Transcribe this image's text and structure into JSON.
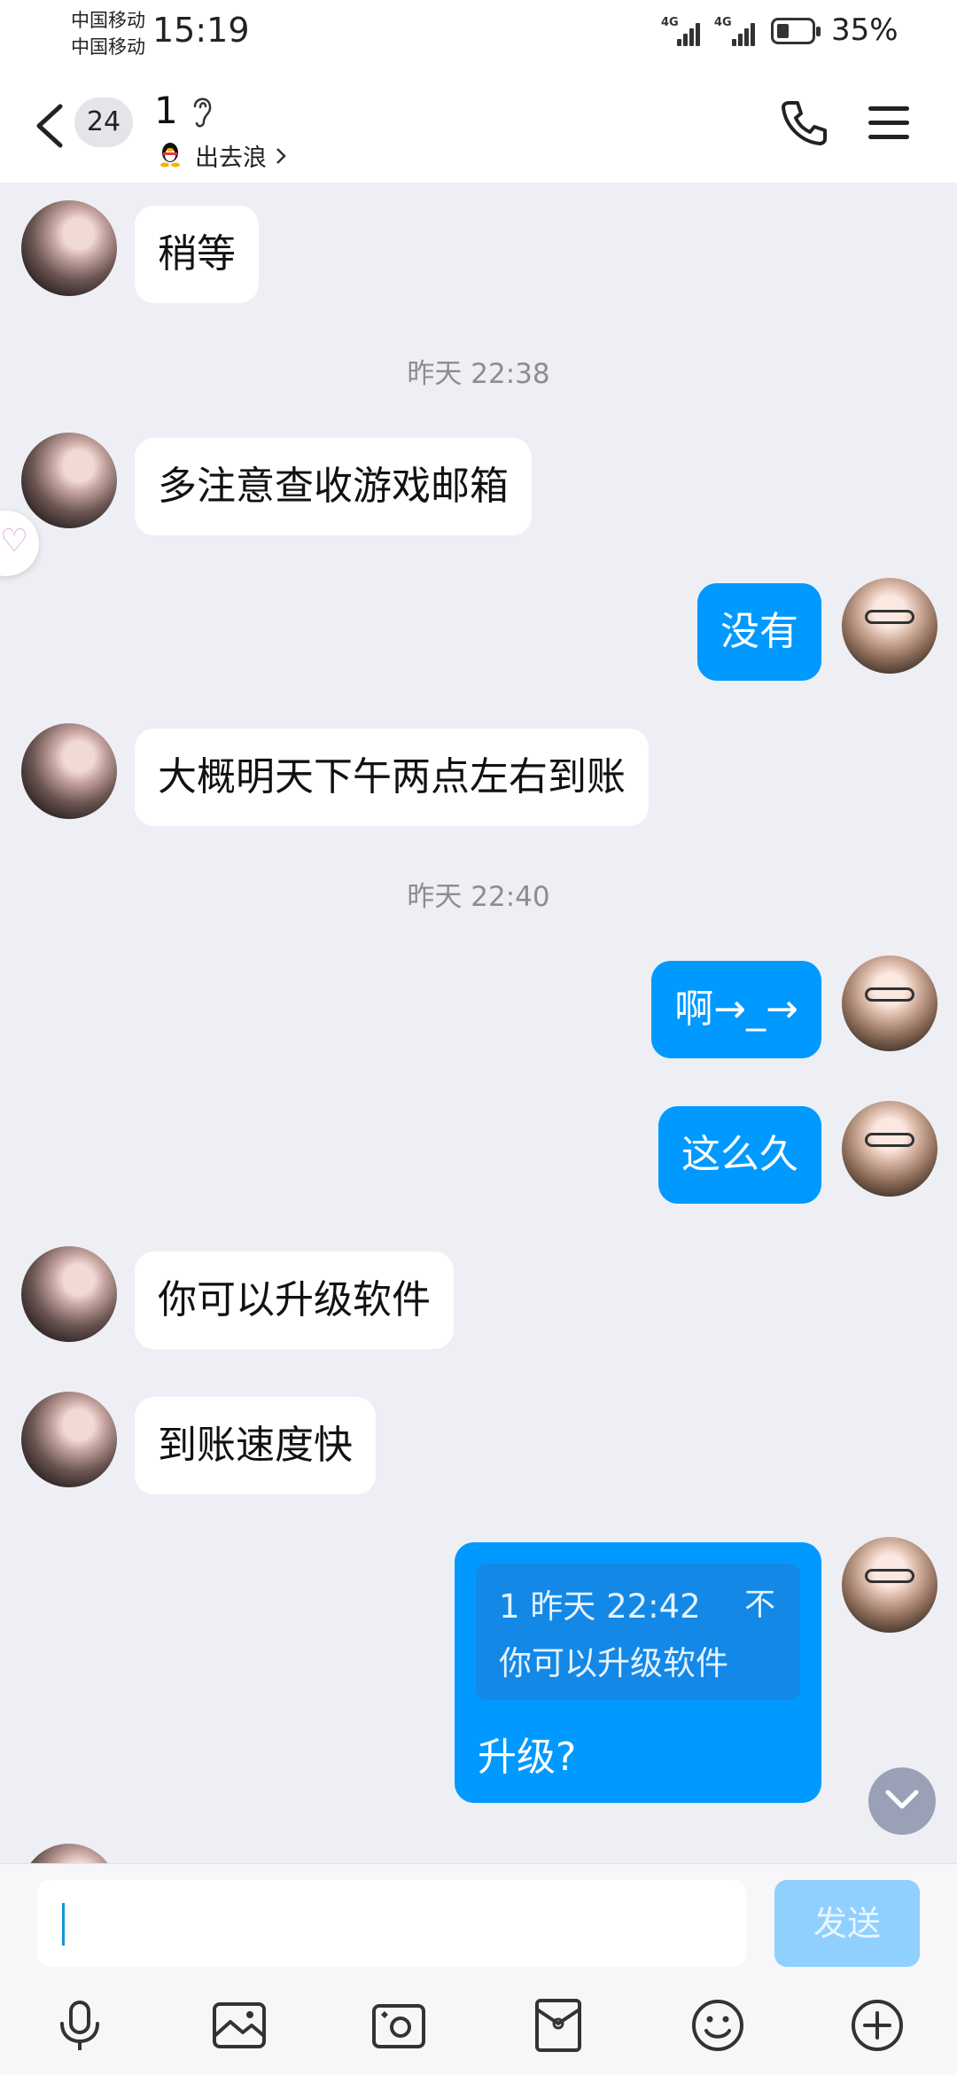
{
  "status_bar": {
    "carrier_1": "中国移动",
    "carrier_2": "中国移动",
    "time": "15:19",
    "signal_1": "4G",
    "signal_2": "4G",
    "battery": "35%",
    "battery_level": 0.35
  },
  "header": {
    "unread_count": "24",
    "contact_name": "1",
    "status_text": "出去浪",
    "icons": [
      "back-arrow-icon",
      "ear-icon",
      "qq-penguin-icon",
      "phone-icon",
      "menu-icon"
    ]
  },
  "messages": {
    "m1": "稍等",
    "t1": "昨天 22:38",
    "m2": "多注意查收游戏邮箱",
    "m3": "没有",
    "m4": "大概明天下午两点左右到账",
    "t2": "昨天 22:40",
    "m5": "啊→_→",
    "m6": "这么久",
    "m7": "你可以升级软件",
    "m8": "到账速度快",
    "reply": {
      "quote_sender": "1",
      "quote_time": "昨天 22:42",
      "quote_mark": "不",
      "quote_text": "你可以升级软件",
      "text": "升级?"
    }
  },
  "input": {
    "placeholder": "",
    "send_label": "发送"
  },
  "toolbar": {
    "icons": [
      "microphone-icon",
      "image-icon",
      "camera-icon",
      "red-packet-icon",
      "emoji-icon",
      "plus-icon"
    ]
  },
  "colors": {
    "accent": "#0099ff",
    "chat_background": "#eeeff4",
    "send_disabled": "#8fd0ff"
  }
}
